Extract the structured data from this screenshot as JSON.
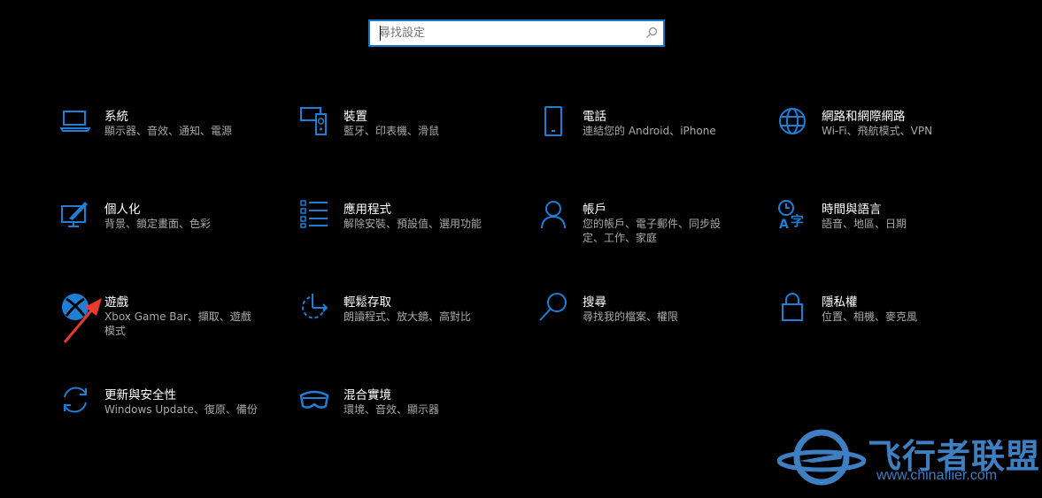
{
  "search": {
    "placeholder": "尋找設定",
    "icon": "search-icon"
  },
  "accent_color": "#1f7fd6",
  "items": [
    {
      "id": "system",
      "title": "系統",
      "subtitle": "顯示器、音效、通知、電源",
      "icon": "laptop-icon"
    },
    {
      "id": "devices",
      "title": "裝置",
      "subtitle": "藍牙、印表機、滑鼠",
      "icon": "devices-icon"
    },
    {
      "id": "phone",
      "title": "電話",
      "subtitle": "連結您的 Android、iPhone",
      "icon": "phone-icon"
    },
    {
      "id": "network",
      "title": "網路和網際網路",
      "subtitle": "Wi-Fi、飛航模式、VPN",
      "icon": "globe-icon"
    },
    {
      "id": "personalization",
      "title": "個人化",
      "subtitle": "背景、鎖定畫面、色彩",
      "icon": "paint-icon"
    },
    {
      "id": "apps",
      "title": "應用程式",
      "subtitle": "解除安裝、預設值、選用功能",
      "icon": "list-icon"
    },
    {
      "id": "accounts",
      "title": "帳戶",
      "subtitle": "您的帳戶、電子郵件、同步設定、工作、家庭",
      "icon": "person-icon"
    },
    {
      "id": "time",
      "title": "時間與語言",
      "subtitle": "語音、地區、日期",
      "icon": "time-language-icon"
    },
    {
      "id": "gaming",
      "title": "遊戲",
      "subtitle": "Xbox Game Bar、擷取、遊戲模式",
      "icon": "xbox-icon"
    },
    {
      "id": "ease",
      "title": "輕鬆存取",
      "subtitle": "朗讀程式、放大鏡、高對比",
      "icon": "ease-of-access-icon"
    },
    {
      "id": "search",
      "title": "搜尋",
      "subtitle": "尋找我的檔案、權限",
      "icon": "search-icon"
    },
    {
      "id": "privacy",
      "title": "隱私權",
      "subtitle": "位置、相機、麥克風",
      "icon": "lock-icon"
    },
    {
      "id": "update",
      "title": "更新與安全性",
      "subtitle": "Windows Update、復原、備份",
      "icon": "sync-icon"
    },
    {
      "id": "mixed",
      "title": "混合實境",
      "subtitle": "環境、音效、顯示器",
      "icon": "headset-icon"
    }
  ],
  "watermark": {
    "name": "飞行者联盟",
    "url": "www.chinaflier.com"
  }
}
